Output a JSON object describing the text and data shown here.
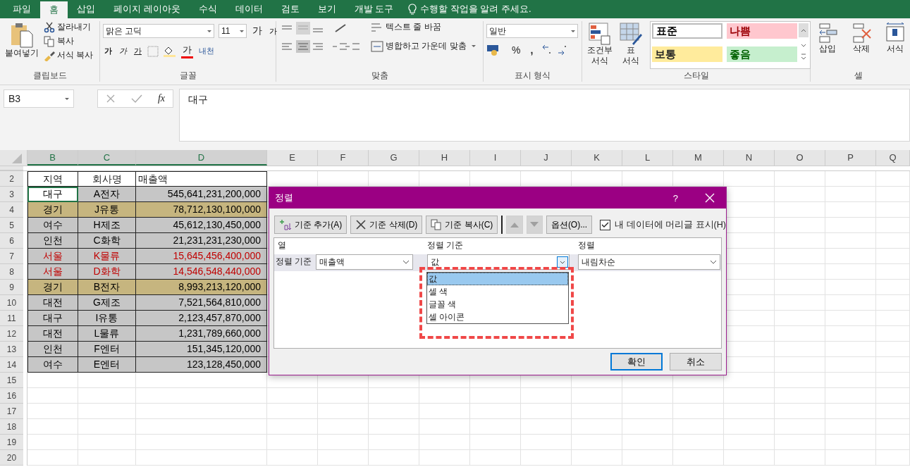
{
  "tabs": [
    {
      "label": "파일",
      "selected": false
    },
    {
      "label": "홈",
      "selected": true
    },
    {
      "label": "삽입",
      "selected": false
    },
    {
      "label": "페이지 레이아웃",
      "selected": false
    },
    {
      "label": "수식",
      "selected": false
    },
    {
      "label": "데이터",
      "selected": false
    },
    {
      "label": "검토",
      "selected": false
    },
    {
      "label": "보기",
      "selected": false
    },
    {
      "label": "개발 도구",
      "selected": false
    }
  ],
  "tell_me": "수행할 작업을 알려 주세요.",
  "ribbon": {
    "clipboard": {
      "paste": "붙여넣기",
      "cut": "잘라내기",
      "copy": "복사",
      "format_painter": "서식 복사",
      "label": "클립보드"
    },
    "font": {
      "name": "맑은 고딕",
      "size": "11",
      "grow": "가",
      "shrink": "가",
      "bold": "가",
      "italic": "가",
      "underline": "가",
      "font_color": "가",
      "phonetic": "내천",
      "label": "글꼴"
    },
    "alignment": {
      "wrap": "텍스트 줄 바꿈",
      "merge": "병합하고 가운데 맞춤",
      "label": "맞춤"
    },
    "number": {
      "format": "일반",
      "percent": "%",
      "comma": ",",
      "label": "표시 형식"
    },
    "styles": {
      "conditional": [
        "조건부",
        "서식"
      ],
      "table": [
        "표",
        "서식"
      ],
      "cells": [
        {
          "label": "표준",
          "color": "#ffffff",
          "font": {
            "color": "#000000"
          }
        },
        {
          "label": "나쁨",
          "color": "#ffc7ce",
          "font": {
            "color": "#9c0006"
          }
        },
        {
          "label": "보통",
          "color": "#ffeb9c"
        },
        {
          "label": "좋음",
          "color": "#c6efce",
          "font": {
            "color": "#006100"
          }
        }
      ],
      "label": "스타일"
    },
    "cells": {
      "insert": "삽입",
      "delete": "삭제",
      "format": "서식",
      "label": "셀"
    }
  },
  "formula_bar": {
    "name_box": "B3",
    "function_label": "fx",
    "formula": "대구"
  },
  "sheet": {
    "columns": [
      "B",
      "C",
      "D",
      "E",
      "F",
      "G",
      "H",
      "I",
      "J",
      "K",
      "L",
      "M",
      "N",
      "O",
      "P",
      "Q"
    ],
    "header": {
      "row": "2",
      "cells": [
        "지역",
        "회사명",
        "매출액"
      ]
    },
    "rows": [
      {
        "row": "3",
        "cells": [
          "대구",
          "A전자",
          "545,641,231,200,000"
        ],
        "color": "#c6c6c6",
        "font": {
          "color": "#000000"
        },
        "active": true
      },
      {
        "row": "4",
        "cells": [
          "경기",
          "J유통",
          "78,712,130,100,000"
        ],
        "color": "#c6b57f",
        "active": false
      },
      {
        "row": "5",
        "cells": [
          "여수",
          "H제조",
          "45,612,130,450,000"
        ],
        "color": "#c6c6c6",
        "font": {
          "color": "#000000"
        },
        "active": false
      },
      {
        "row": "6",
        "cells": [
          "인천",
          "C화학",
          "21,231,231,230,000"
        ],
        "color": "#c6c6c6",
        "font": {
          "color": "#000000"
        },
        "active": false
      },
      {
        "row": "7",
        "cells": [
          "서울",
          "K물류",
          "15,645,456,400,000"
        ],
        "color": "#c6c6c6",
        "font": {
          "color": "#c00000"
        },
        "active": false
      },
      {
        "row": "8",
        "cells": [
          "서울",
          "D화학",
          "14,546,548,440,000"
        ],
        "color": "#c6c6c6",
        "font": {
          "color": "#c00000"
        },
        "active": false
      },
      {
        "row": "9",
        "cells": [
          "경기",
          "B전자",
          "8,993,213,120,000"
        ],
        "color": "#c6b57f",
        "active": false
      },
      {
        "row": "10",
        "cells": [
          "대전",
          "G제조",
          "7,521,564,810,000"
        ],
        "color": "#c6c6c6",
        "font": {
          "color": "#000000"
        },
        "active": false
      },
      {
        "row": "11",
        "cells": [
          "대구",
          "I유통",
          "2,123,457,870,000"
        ],
        "color": "#c6c6c6",
        "font": {
          "color": "#000000"
        },
        "active": false
      },
      {
        "row": "12",
        "cells": [
          "대전",
          "L물류",
          "1,231,789,660,000"
        ],
        "color": "#c6c6c6",
        "font": {
          "color": "#000000"
        },
        "active": false
      },
      {
        "row": "13",
        "cells": [
          "인천",
          "F엔터",
          "151,345,120,000"
        ],
        "color": "#c6c6c6",
        "font": {
          "color": "#000000"
        },
        "active": false
      },
      {
        "row": "14",
        "cells": [
          "여수",
          "E엔터",
          "123,128,450,000"
        ],
        "color": "#c6c6c6",
        "font": {
          "color": "#000000"
        },
        "active": false
      }
    ],
    "empty_rows": [
      "15",
      "16",
      "17",
      "18",
      "19",
      "20"
    ]
  },
  "dialog": {
    "title": "정렬",
    "help": "?",
    "toolbar": [
      {
        "label": "기준 추가(A)",
        "kind": "add"
      },
      {
        "label": "기준 삭제(D)",
        "kind": "delete"
      },
      {
        "label": "기준 복사(C)",
        "kind": "copy"
      }
    ],
    "move": [
      {
        "kind": "up",
        "disabled": true
      },
      {
        "kind": "down",
        "disabled": true
      }
    ],
    "options": "옵션(O)...",
    "header_checkbox": {
      "label": "내 데이터에 머리글 표시(H)",
      "checked": true
    },
    "columns": [
      "열",
      "정렬 기준",
      "정렬"
    ],
    "level": {
      "label": "정렬 기준",
      "column": "매출액",
      "sort_on": "값",
      "order": "내림차순"
    },
    "dropdown": [
      {
        "label": "값",
        "selected": true
      },
      {
        "label": "셀 색",
        "selected": false
      },
      {
        "label": "글꼴 색",
        "selected": false
      },
      {
        "label": "셀 아이콘",
        "selected": false
      }
    ],
    "ok": "확인",
    "cancel": "취소"
  }
}
